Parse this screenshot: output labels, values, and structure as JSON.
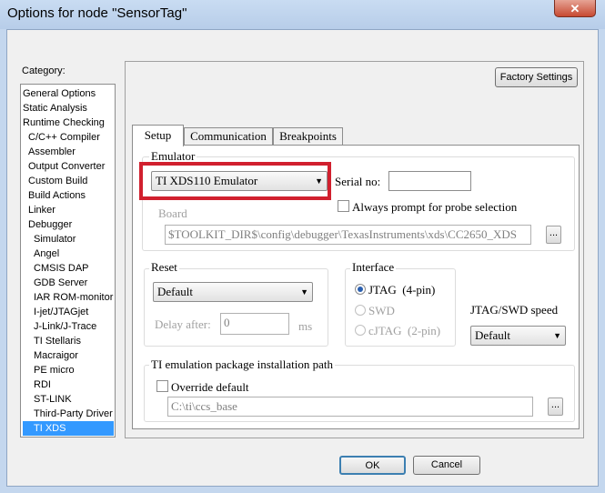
{
  "window": {
    "title": "Options for node \"SensorTag\"",
    "close_glyph": "✕"
  },
  "category": {
    "label": "Category:",
    "items": [
      "General Options",
      "Static Analysis",
      "Runtime Checking",
      "C/C++ Compiler",
      "Assembler",
      "Output Converter",
      "Custom Build",
      "Build Actions",
      "Linker",
      "Debugger",
      "Simulator",
      "Angel",
      "CMSIS DAP",
      "GDB Server",
      "IAR ROM-monitor",
      "I-jet/JTAGjet",
      "J-Link/J-Trace",
      "TI Stellaris",
      "Macraigor",
      "PE micro",
      "RDI",
      "ST-LINK",
      "Third-Party Driver",
      "TI XDS"
    ],
    "selected": "TI XDS"
  },
  "factory_settings": "Factory Settings",
  "tabs": [
    "Setup",
    "Communication",
    "Breakpoints"
  ],
  "emulator": {
    "group_label": "Emulator",
    "selected": "TI XDS110 Emulator",
    "serial_label": "Serial no:",
    "serial_value": "",
    "always_prompt_label": "Always prompt for probe selection",
    "board_label": "Board",
    "board_path": "$TOOLKIT_DIR$\\config\\debugger\\TexasInstruments\\xds\\CC2650_XDS",
    "browse": "..."
  },
  "reset": {
    "group_label": "Reset",
    "selected": "Default",
    "delay_label": "Delay after:",
    "delay_value": "0",
    "delay_unit": "ms"
  },
  "interface": {
    "group_label": "Interface",
    "options": [
      "JTAG  (4-pin)",
      "SWD",
      "cJTAG  (2-pin)"
    ],
    "selected": "JTAG  (4-pin)"
  },
  "speed": {
    "label": "JTAG/SWD speed",
    "selected": "Default"
  },
  "ti_emulation": {
    "group_label": "TI emulation package installation path",
    "override_label": "Override default",
    "path": "C:\\ti\\ccs_base",
    "browse": "..."
  },
  "buttons": {
    "ok": "OK",
    "cancel": "Cancel"
  }
}
